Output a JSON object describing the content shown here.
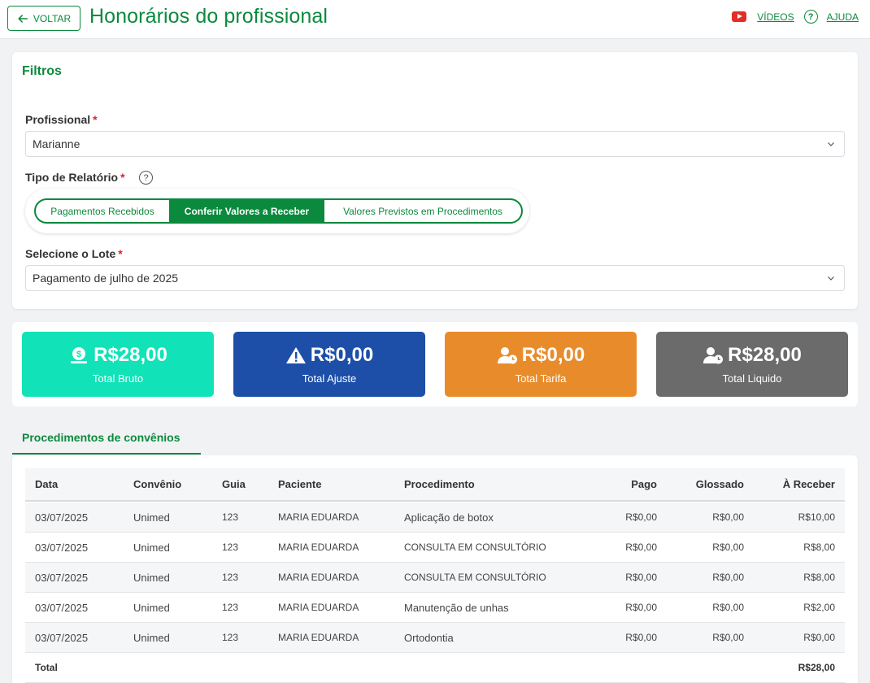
{
  "header": {
    "back_label": "VOLTAR",
    "title": "Honorários do profissional",
    "videos_label": "VÍDEOS",
    "help_label": "AJUDA"
  },
  "filters": {
    "title": "Filtros",
    "profissional_label": "Profissional",
    "profissional_value": "Marianne",
    "tipo_label": "Tipo de Relatório",
    "tipo_options": [
      "Pagamentos Recebidos",
      "Conferir Valores a Receber",
      "Valores Previstos em Procedimentos"
    ],
    "tipo_selected": "Conferir Valores a Receber",
    "lote_label": "Selecione o Lote",
    "lote_value": "Pagamento de julho de 2025",
    "required_mark": "*"
  },
  "summary": [
    {
      "value": "R$28,00",
      "label": "Total Bruto",
      "color": "#12e2b8",
      "icon": "money-bag-icon"
    },
    {
      "value": "R$0,00",
      "label": "Total Ajuste",
      "color": "#1d4fa8",
      "icon": "warning-icon"
    },
    {
      "value": "R$0,00",
      "label": "Total Tarifa",
      "color": "#e88c2b",
      "icon": "user-clock-icon"
    },
    {
      "value": "R$28,00",
      "label": "Total Liquido",
      "color": "#6b6b6b",
      "icon": "user-clock-icon"
    }
  ],
  "tab": {
    "label": "Procedimentos de convênios"
  },
  "table": {
    "columns": [
      "Data",
      "Convênio",
      "Guia",
      "Paciente",
      "Procedimento",
      "Pago",
      "Glossado",
      "À Receber"
    ],
    "rows": [
      [
        "03/07/2025",
        "Unimed",
        "123",
        "MARIA EDUARDA",
        "Aplicação de botox",
        "R$0,00",
        "R$0,00",
        "R$10,00"
      ],
      [
        "03/07/2025",
        "Unimed",
        "123",
        "MARIA EDUARDA",
        "CONSULTA EM CONSULTÓRIO",
        "R$0,00",
        "R$0,00",
        "R$8,00"
      ],
      [
        "03/07/2025",
        "Unimed",
        "123",
        "MARIA EDUARDA",
        "CONSULTA EM CONSULTÓRIO",
        "R$0,00",
        "R$0,00",
        "R$8,00"
      ],
      [
        "03/07/2025",
        "Unimed",
        "123",
        "MARIA EDUARDA",
        "Manutenção de unhas",
        "R$0,00",
        "R$0,00",
        "R$2,00"
      ],
      [
        "03/07/2025",
        "Unimed",
        "123",
        "MARIA EDUARDA",
        "Ortodontia",
        "R$0,00",
        "R$0,00",
        "R$0,00"
      ]
    ],
    "total_label": "Total",
    "total_value": "R$28,00"
  },
  "colors": {
    "brand": "#0b8a3d",
    "required": "#d9232e"
  }
}
